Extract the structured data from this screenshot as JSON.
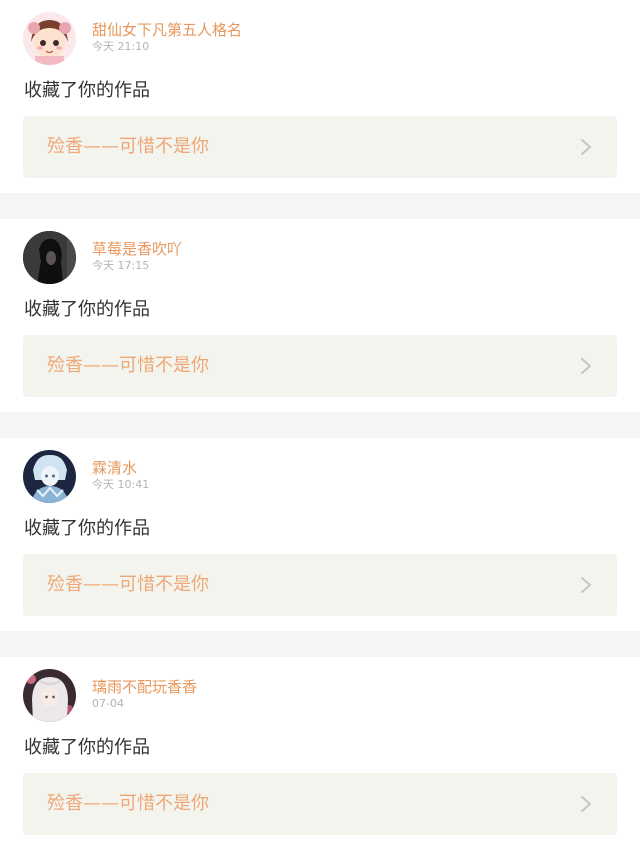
{
  "feed": {
    "items": [
      {
        "username": "甜仙女下凡第五人格名",
        "time": "今天 21:10",
        "action": "收藏了你的作品",
        "work_title": "殓香——可惜不是你",
        "avatar_icon": "cartoon-girl-avatar-icon"
      },
      {
        "username": "草莓是香吹吖",
        "time": "今天 17:15",
        "action": "收藏了你的作品",
        "work_title": "殓香——可惜不是你",
        "avatar_icon": "dark-figure-avatar-icon"
      },
      {
        "username": "霖清水",
        "time": "今天 10:41",
        "action": "收藏了你的作品",
        "work_title": "殓香——可惜不是你",
        "avatar_icon": "ice-character-avatar-icon"
      },
      {
        "username": "璃雨不配玩香香",
        "time": "07-04",
        "action": "收藏了你的作品",
        "work_title": "殓香——可惜不是你",
        "avatar_icon": "white-hair-character-avatar-icon"
      }
    ]
  },
  "colors": {
    "username": "#e8985e",
    "time": "#b3b3b3",
    "action_text": "#333333",
    "work_title": "#eea877",
    "work_box_bg": "#f4f4ee",
    "divider": "#f7f5f3",
    "chevron": "#c4c4c4"
  }
}
